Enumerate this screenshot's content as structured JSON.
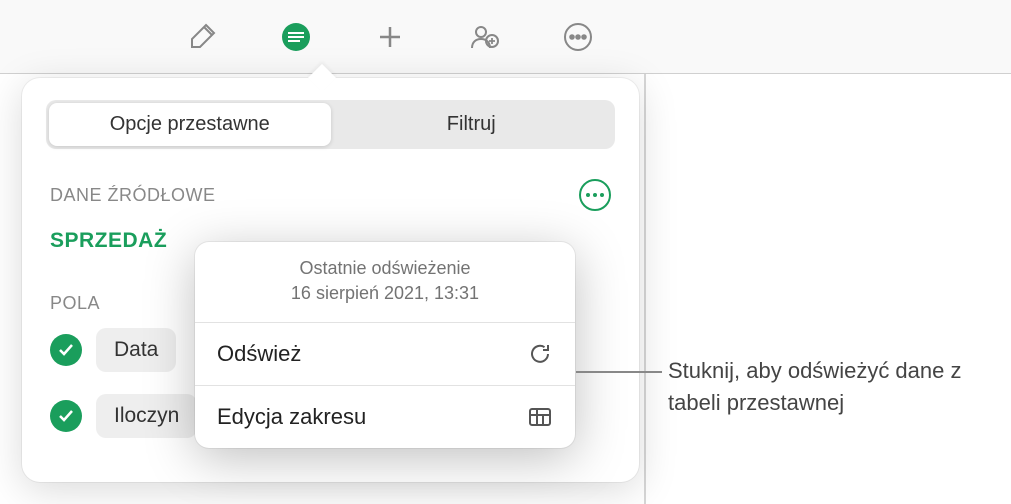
{
  "toolbar": {
    "items": [
      "format",
      "pivot",
      "insert",
      "collaborate",
      "more"
    ]
  },
  "popover": {
    "tabs": {
      "pivot": "Opcje przestawne",
      "filter": "Filtruj"
    },
    "source": {
      "label": "DANE ŹRÓDŁOWE",
      "name": "SPRZEDAŻ"
    },
    "fields": {
      "label": "POLA",
      "items": [
        "Data",
        "Iloczyn"
      ]
    }
  },
  "submenu": {
    "header_line1": "Ostatnie odświeżenie",
    "header_line2": "16 sierpień 2021, 13:31",
    "refresh": "Odśwież",
    "edit_range": "Edycja zakresu"
  },
  "callout": "Stuknij, aby odświeżyć dane z tabeli przestawnej"
}
